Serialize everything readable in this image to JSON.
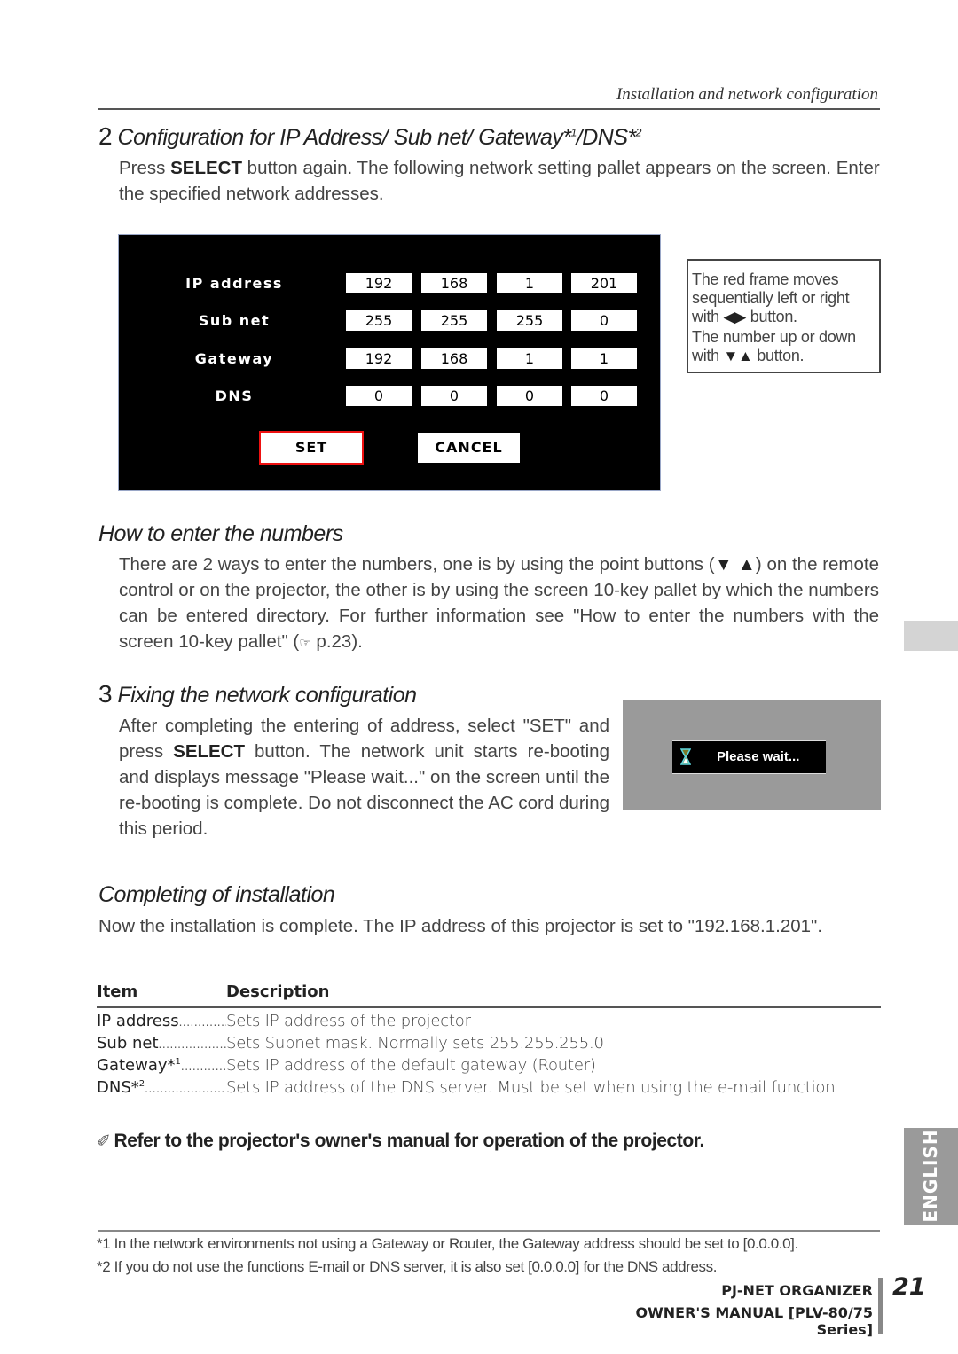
{
  "running_head": "Installation and network configuration",
  "step2": {
    "number": "2",
    "title": "Configuration for IP Address/ Sub net/ Gateway*",
    "sup1": "1",
    "title_mid": "/DNS*",
    "sup2": "2",
    "para_pre": "Press ",
    "para_bold": "SELECT",
    "para_post": " button again. The following network setting pallet appears on the screen. Enter the specified network addresses."
  },
  "osd": {
    "rows": [
      {
        "label": "IP address",
        "values": [
          "192",
          "168",
          "1",
          "201"
        ]
      },
      {
        "label": "Sub net",
        "values": [
          "255",
          "255",
          "255",
          "0"
        ]
      },
      {
        "label": "Gateway",
        "values": [
          "192",
          "168",
          "1",
          "1"
        ]
      },
      {
        "label": "DNS",
        "values": [
          "0",
          "0",
          "0",
          "0"
        ]
      }
    ],
    "set_label": "SET",
    "cancel_label": "CANCEL",
    "selected_button": "SET",
    "frame_color": "#ee1111"
  },
  "note": {
    "line1": "The red frame moves sequentially left or right",
    "with": "with",
    "lr_arrows": "◀▶",
    "button": "button.",
    "line3": "The number up or down",
    "ud_arrows": "▼▲"
  },
  "how_to": {
    "title": "How to enter the numbers",
    "para_pre": "There are 2 ways to enter the numbers, one is by using the point buttons (",
    "arrows": "▼ ▲",
    "para_post": ") on the remote control or on the projector, the other is by using the screen 10-key pallet by which the numbers can be entered directory. For further information see \"How to enter the numbers with the screen 10-key pallet\" (",
    "ref_icon": "☞",
    "ref_page": " p.23)."
  },
  "step3": {
    "number": "3",
    "title": "Fixing the network configuration",
    "para_pre": "After completing the entering of address, select \"SET\" and press ",
    "para_bold": "SELECT",
    "para_post": " button. The network unit starts re-booting and displays message \"Please wait...\" on the screen until the re-booting is complete. Do not disconnect the AC cord during this period.",
    "wait_message": "Please wait..."
  },
  "completing": {
    "title": "Completing of installation",
    "para": "Now the installation is complete. The IP address of this projector is set to \"192.168.1.201\"."
  },
  "table": {
    "headers": [
      "Item",
      "Description"
    ],
    "rows": [
      {
        "item": "IP address",
        "sup": "",
        "dots": "..............",
        "desc": "Sets IP address of the projector"
      },
      {
        "item": "Sub net",
        "sup": "",
        "dots": "........................",
        "desc": "Sets Subnet mask. Normally sets 255.255.255.0"
      },
      {
        "item": "Gateway*",
        "sup": "1",
        "dots": "..............",
        "desc": "Sets IP address of the default gateway (Router)"
      },
      {
        "item": "DNS*",
        "sup": "2",
        "dots": "..............................",
        "desc": "Sets IP address of the DNS server. Must be set when using the e-mail function"
      }
    ]
  },
  "refer_note": "Refer to the projector's owner's manual for operation of the projector.",
  "footnotes": [
    "*1 In the network environments not using a Gateway or Router, the Gateway address should be set to [0.0.0.0].",
    "*2 If you do not use the functions E-mail or DNS server, it is also set [0.0.0.0] for the DNS address."
  ],
  "footer": {
    "product": "PJ-NET ORGANIZER",
    "manual": "OWNER'S MANUAL [PLV-80/75 Series]",
    "page": "21"
  },
  "side_tab": "ENGLISH"
}
